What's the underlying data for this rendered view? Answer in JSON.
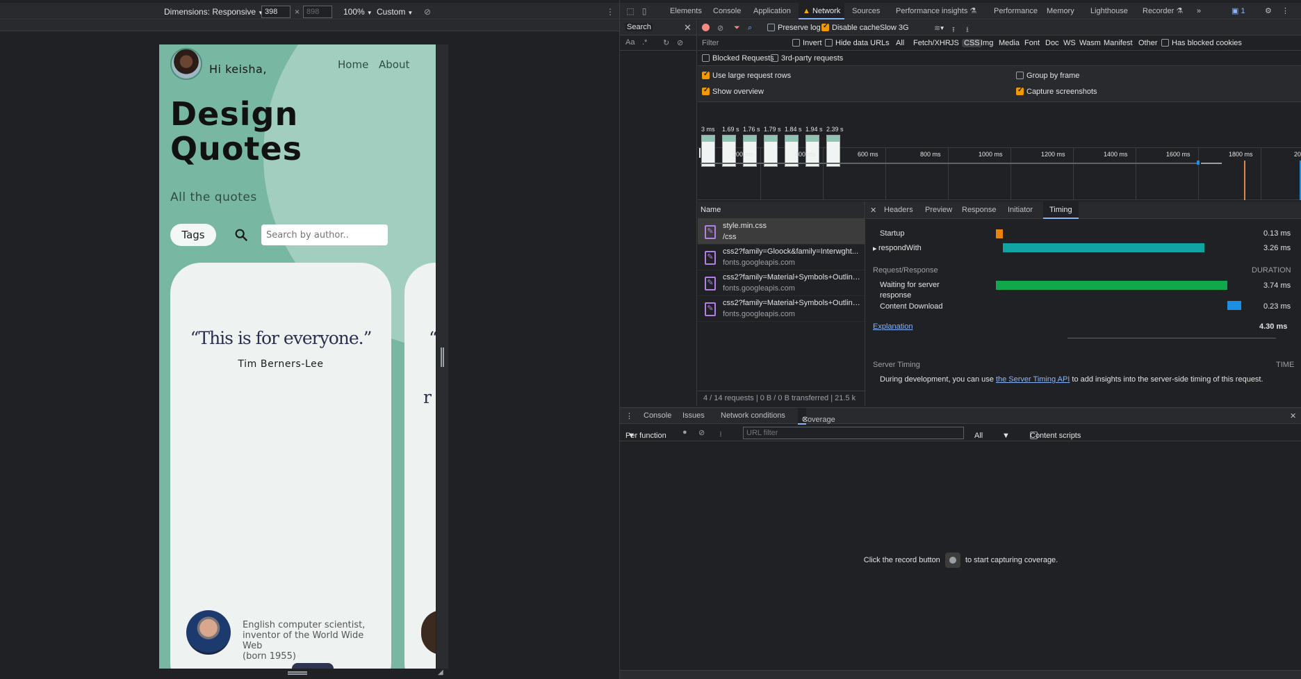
{
  "device_toolbar": {
    "dimensions_label": "Dimensions: Responsive",
    "width": "398",
    "height": "898",
    "zoom": "100%",
    "throttle": "Custom"
  },
  "site": {
    "greeting": "Hi keisha,",
    "nav": [
      "Home",
      "About"
    ],
    "title_line1": "Design",
    "title_line2": "Quotes",
    "subtitle": "All the quotes",
    "tags_label": "Tags",
    "search_placeholder": "Search by author..",
    "quote": "“This is for everyone.”",
    "quote_author": "Tim Berners-Lee",
    "quote_peek": "“",
    "quote_peek2": "r",
    "bio_line1": "English computer scientist,",
    "bio_line2": "inventor of the World Wide Web",
    "bio_line3": "(born 1955)"
  },
  "devtools": {
    "tabs": [
      "Elements",
      "Console",
      "Application",
      "Network",
      "Sources",
      "Performance insights",
      "Performance",
      "Memory",
      "Lighthouse",
      "Recorder"
    ],
    "active_tab": "Network",
    "badge_count": "1",
    "search_label": "Search",
    "search_tools": [
      "Aa",
      ".*"
    ],
    "toolbar": {
      "preserve_log": "Preserve log",
      "disable_cache": "Disable cache",
      "throttle": "Slow 3G"
    },
    "filter": {
      "placeholder": "Filter",
      "invert": "Invert",
      "hide_data_urls": "Hide data URLs",
      "types": [
        "All",
        "Fetch/XHR",
        "JS",
        "CSS",
        "Img",
        "Media",
        "Font",
        "Doc",
        "WS",
        "Wasm",
        "Manifest",
        "Other"
      ],
      "active_type": "CSS",
      "has_blocked_cookies": "Has blocked cookies",
      "blocked_requests": "Blocked Requests",
      "third_party": "3rd-party requests"
    },
    "settings": {
      "large_rows": "Use large request rows",
      "group_by_frame": "Group by frame",
      "show_overview": "Show overview",
      "capture_screenshots": "Capture screenshots"
    },
    "filmstrip": [
      "3 ms",
      "1.69 s",
      "1.76 s",
      "1.79 s",
      "1.84 s",
      "1.94 s",
      "2.39 s"
    ],
    "overview_ticks": [
      "200 ms",
      "400 ms",
      "600 ms",
      "800 ms",
      "1000 ms",
      "1200 ms",
      "1400 ms",
      "1600 ms",
      "1800 ms",
      "20"
    ],
    "requests_header": "Name",
    "requests": [
      {
        "name": "style.min.css",
        "sub": "/css"
      },
      {
        "name": "css2?family=Gloock&family=Interwght...",
        "sub": "fonts.googleapis.com"
      },
      {
        "name": "css2?family=Material+Symbols+Outline...",
        "sub": "fonts.googleapis.com"
      },
      {
        "name": "css2?family=Material+Symbols+Outline...",
        "sub": "fonts.googleapis.com"
      }
    ],
    "status_bar": "4 / 14 requests  |  0 B / 0 B transferred  |  21.5 k",
    "detail_tabs": [
      "Headers",
      "Preview",
      "Response",
      "Initiator",
      "Timing"
    ],
    "active_detail_tab": "Timing",
    "timing": {
      "sw_rows": [
        {
          "label": "Startup",
          "value": "0.13 ms",
          "color": "#e8830c"
        },
        {
          "label": "respondWith",
          "value": "3.26 ms",
          "color": "#12a3a3"
        }
      ],
      "section_label": "Request/Response",
      "duration_label": "DURATION",
      "rr_rows": [
        {
          "label1": "Waiting for server",
          "label2": "response",
          "value": "3.74 ms",
          "color": "#0fa84a"
        },
        {
          "label1": "Content Download",
          "label2": "",
          "value": "0.23 ms",
          "color": "#1a8fe3"
        }
      ],
      "explanation": "Explanation",
      "total": "4.30 ms",
      "server_timing_label": "Server Timing",
      "time_label": "TIME",
      "server_timing_text_a": "During development, you can use",
      "server_timing_link": "the Server Timing API",
      "server_timing_text_b": "to add insights into the server-side timing of this request."
    },
    "drawer_tabs": [
      "Console",
      "Issues",
      "Network conditions",
      "Coverage"
    ],
    "active_drawer_tab": "Coverage",
    "coverage": {
      "mode": "Per function",
      "url_filter_placeholder": "URL filter",
      "type_select": "All",
      "content_scripts": "Content scripts",
      "msg_a": "Click the record button",
      "msg_b": "to start capturing coverage."
    }
  }
}
